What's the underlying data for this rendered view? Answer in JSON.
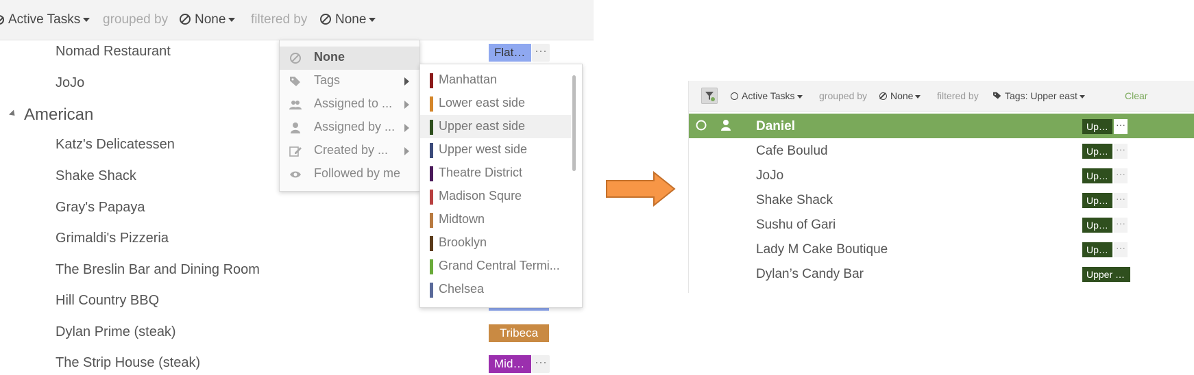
{
  "left": {
    "toolbar": {
      "active_tasks": "Active Tasks",
      "grouped_by": "grouped by",
      "group_value": "None",
      "filtered_by": "filtered by",
      "filter_value": "None"
    },
    "rows": [
      {
        "name": "Nomad Restaurant",
        "tag": "Flat…",
        "tag_color": "#8fa8f0"
      },
      {
        "name": "JoJo"
      },
      {
        "name": "Katz's Delicatessen"
      },
      {
        "name": "Shake Shack"
      },
      {
        "name": "Gray's Papaya"
      },
      {
        "name": "Grimaldi's Pizzeria"
      },
      {
        "name": "The Breslin Bar and Dining Room"
      },
      {
        "name": "Hill Country BBQ"
      },
      {
        "name": "Dylan Prime (steak)",
        "tag": "Tribeca",
        "tag_color": "#c98a43"
      },
      {
        "name": "The Strip House (steak)",
        "tag": "Mid…",
        "tag_color": "#9b2fae"
      }
    ],
    "group_header": "American",
    "filter_menu": [
      {
        "label": "None",
        "icon": "none-icon"
      },
      {
        "label": "Tags",
        "icon": "tags-icon"
      },
      {
        "label": "Assigned to ...",
        "icon": "users-icon"
      },
      {
        "label": "Assigned by ...",
        "icon": "user-icon"
      },
      {
        "label": "Created by ...",
        "icon": "edit-icon"
      },
      {
        "label": "Followed by me",
        "icon": "eye-icon"
      }
    ],
    "tags_menu": [
      {
        "label": "Manhattan",
        "color": "#8b1a1a"
      },
      {
        "label": "Lower east side",
        "color": "#d4862a"
      },
      {
        "label": "Upper east side",
        "color": "#2f4f1e"
      },
      {
        "label": "Upper west side",
        "color": "#3b4a7a"
      },
      {
        "label": "Theatre District",
        "color": "#4a1a5a"
      },
      {
        "label": "Madison Squre",
        "color": "#b84040"
      },
      {
        "label": "Midtown",
        "color": "#b87a40"
      },
      {
        "label": "Brooklyn",
        "color": "#5a3a1a"
      },
      {
        "label": "Grand Central Termi...",
        "color": "#6aaa3a"
      },
      {
        "label": "Chelsea",
        "color": "#5a6a9a"
      }
    ]
  },
  "right": {
    "toolbar": {
      "active_tasks": "Active Tasks",
      "grouped_by": "grouped by",
      "group_value": "None",
      "filtered_by": "filtered by",
      "filter_value": "Tags: Upper east",
      "clear": "Clear"
    },
    "rows": [
      {
        "name": "Daniel",
        "tag": "Up…"
      },
      {
        "name": "Cafe Boulud",
        "tag": "Up…"
      },
      {
        "name": "JoJo",
        "tag": "Up…"
      },
      {
        "name": "Shake Shack",
        "tag": "Up…"
      },
      {
        "name": "Sushu of Gari",
        "tag": "Up…"
      },
      {
        "name": "Lady M Cake Boutique",
        "tag": "Up…"
      },
      {
        "name": "Dylan’s Candy Bar",
        "tag": "Upper …"
      }
    ]
  },
  "colors": {
    "accent_green": "#7aa95a",
    "tag_dark_green": "#2f4f1e",
    "arrow_orange": "#f79646"
  }
}
